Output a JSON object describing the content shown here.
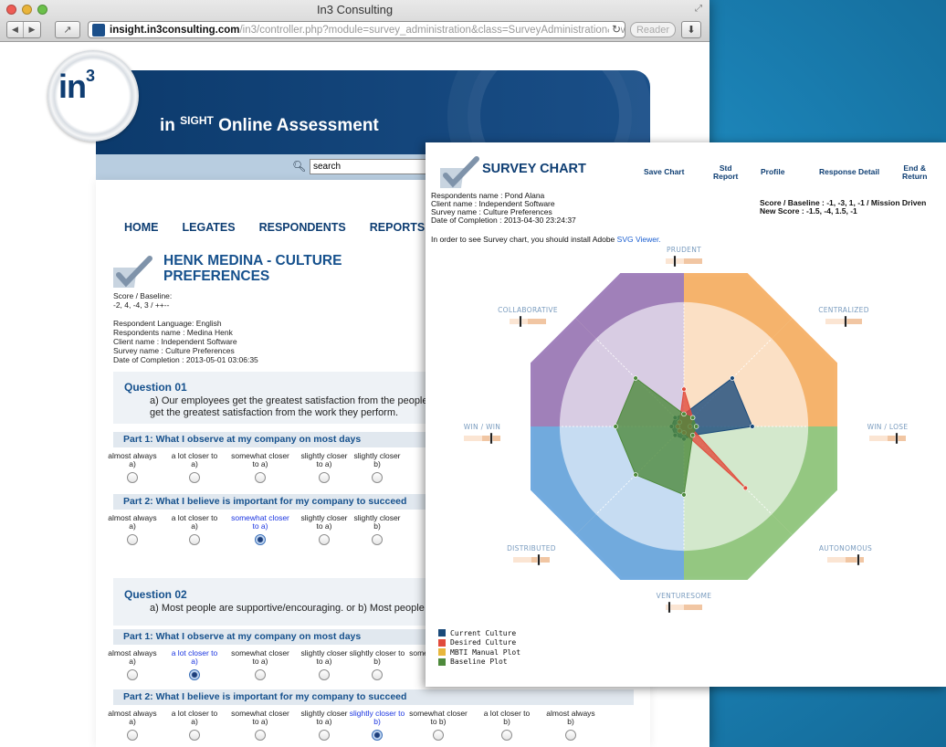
{
  "browser": {
    "window_title": "In3 Consulting",
    "url_host": "insight.in3consulting.com",
    "url_path": "/in3/controller.php?module=survey_administration&class=SurveyAdministration&ev",
    "reader_label": "Reader"
  },
  "site": {
    "logo_text": "in",
    "logo_sup": "3",
    "banner_prefix": "in ",
    "banner_sup": "SIGHT",
    "banner_suffix": " Online Assessment",
    "search_value": "search",
    "menu": [
      "HOME",
      "LEGATES",
      "RESPONDENTS",
      "REPORTS"
    ]
  },
  "respondent": {
    "title": "HENK MEDINA - CULTURE PREFERENCES",
    "score_label": "Score / Baseline:",
    "score_value": "-2, 4, -4, 3 / ++--",
    "language": "Respondent Language: English",
    "name": "Respondents name : Medina Henk",
    "client": "Client name : Independent Software",
    "survey": "Survey name : Culture Preferences",
    "completion": "Date of Completion : 2013-05-01 03:06:35"
  },
  "questions": [
    {
      "title": "Question 01",
      "text_line1": "a) Our employees get the greatest satisfaction from the people",
      "text_line2": "get the greatest satisfaction from the work they perform.",
      "parts": [
        {
          "label": "Part 1: What I observe at my company on most days",
          "selected": -1
        },
        {
          "label": "Part 2: What I believe is important for my company to succeed",
          "selected": 2
        }
      ]
    },
    {
      "title": "Question 02",
      "text_line1": "a) Most people are supportive/encouraging. or b) Most people a",
      "text_line2": "",
      "parts": [
        {
          "label": "Part 1: What I observe at my company on most days",
          "selected": 1
        },
        {
          "label": "Part 2: What I believe is important for my company to succeed",
          "selected": 4
        }
      ]
    }
  ],
  "options": [
    {
      "l1": "almost always",
      "l2": "a)"
    },
    {
      "l1": "a lot closer to",
      "l2": "a)"
    },
    {
      "l1": "somewhat closer",
      "l2": "to a)"
    },
    {
      "l1": "slightly closer",
      "l2": "to a)"
    },
    {
      "l1": "slightly closer to",
      "l2": "b)"
    },
    {
      "l1": "somewhat closer",
      "l2": "to b)"
    },
    {
      "l1": "a lot closer to",
      "l2": "b)"
    },
    {
      "l1": "almost always",
      "l2": "b)"
    }
  ],
  "options_clipped": [
    {
      "l1": "slightly closer",
      "l2": "b)"
    }
  ],
  "popup": {
    "title": "SURVEY CHART",
    "links": {
      "save": "Save Chart",
      "std_l1": "Std",
      "std_l2": "Report",
      "profile": "Profile",
      "response": "Response Detail",
      "end_l1": "End &",
      "end_l2": "Return"
    },
    "info": [
      "Respondents name : Pond Alana",
      "Client name : Independent Software",
      "Survey name : Culture Preferences",
      "Date of Completion : 2013-04-30 23:24:37"
    ],
    "score_line": "Score / Baseline : -1, -3, 1, -1 / Mission Driven",
    "new_score_line": "New Score : -1.5, -4, 1.5, -1",
    "install_prefix": "In order to see Survey chart, you should install Adobe ",
    "install_link": "SVG Viewer."
  },
  "chart_data": {
    "type": "radar",
    "axes": [
      "PRUDENT",
      "CENTRALIZED",
      "WIN / LOSE",
      "AUTONOMOUS",
      "VENTURESOME",
      "DISTRIBUTED",
      "WIN / WIN",
      "COLLABORATIVE"
    ],
    "sector_colors": [
      "#f6b067",
      "#f6b067",
      "#8fc57d",
      "#8fc57d",
      "#6aa6de",
      "#6aa6de",
      "#9c7ab8",
      "#9c7ab8"
    ],
    "series": [
      {
        "name": "Current Culture",
        "color": "#1a4a7a",
        "values": [
          0.1,
          0.55,
          0.55,
          0.1,
          0.1,
          0.1,
          0.1,
          0.1
        ]
      },
      {
        "name": "Desired Culture",
        "color": "#e14b3c",
        "values": [
          0.3,
          0.1,
          0.05,
          0.7,
          0.05,
          0.05,
          0.05,
          0.05
        ]
      },
      {
        "name": "MBTI Manual Plot",
        "color": "#e8b73d",
        "values": []
      },
      {
        "name": "Baseline Plot",
        "color": "#4e8a3c",
        "values": [
          0.1,
          0.1,
          0.1,
          0.1,
          0.55,
          0.55,
          0.55,
          0.55
        ]
      }
    ],
    "sliders": [
      0.25,
      0.55,
      0.75,
      0.85,
      0.1,
      0.7,
      0.75,
      0.3
    ]
  }
}
